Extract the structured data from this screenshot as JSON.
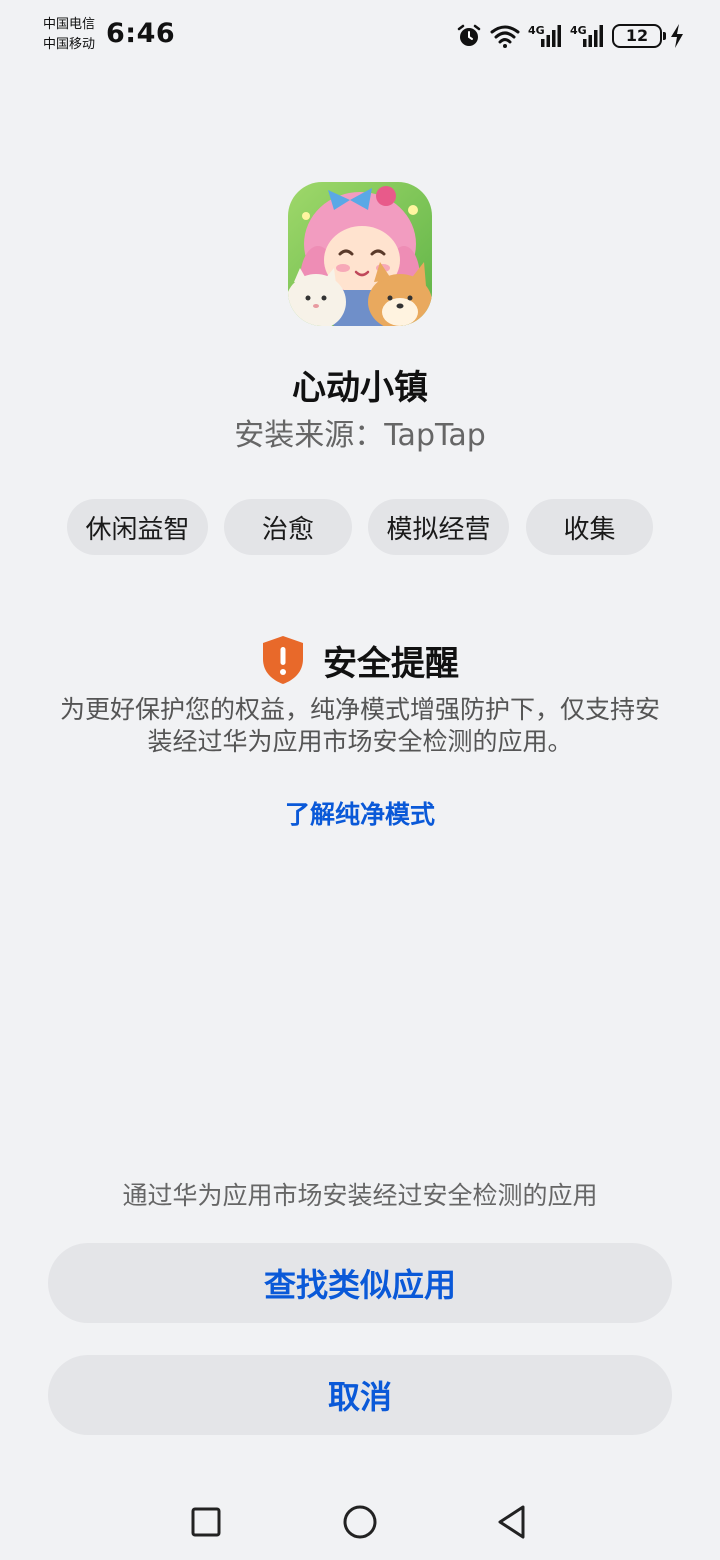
{
  "status_bar": {
    "carrier_1": "中国电信",
    "carrier_2": "中国移动",
    "time": "6:46",
    "net_1": "4G",
    "net_2": "4G",
    "battery": "12",
    "icons": [
      "alarm-icon",
      "wifi-icon",
      "signal-icon",
      "signal-icon",
      "battery-icon",
      "charging-icon"
    ]
  },
  "app": {
    "name": "心动小镇",
    "source": "安装来源：TapTap",
    "tags": [
      "休闲益智",
      "治愈",
      "模拟经营",
      "收集"
    ]
  },
  "warning": {
    "icon": "shield-alert-icon",
    "accent_color": "#e8692a",
    "title": "安全提醒",
    "body": "为更好保护您的权益，纯净模式增强防护下，仅支持安装经过华为应用市场安全检测的应用。",
    "link": "了解纯净模式"
  },
  "bottom": {
    "hint": "通过华为应用市场安装经过安全检测的应用",
    "find_similar": "查找类似应用",
    "cancel": "取消",
    "button_text_color": "#0a59d8"
  },
  "nav": {
    "icons": [
      "recents-icon",
      "home-icon",
      "back-icon"
    ]
  }
}
